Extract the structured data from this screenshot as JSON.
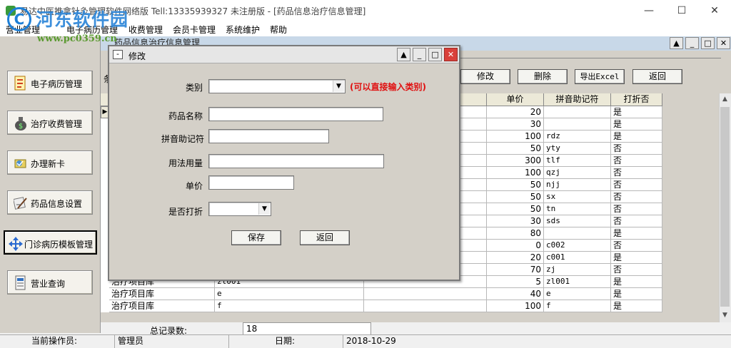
{
  "window": {
    "title": "易达中医推拿针灸管理软件网络版 Tell:13335939327 未注册版 - [药品信息治疗信息管理]",
    "minimize_glyph": "—",
    "maximize_glyph": "☐",
    "close_glyph": "✕"
  },
  "watermark": {
    "text": "河东软件园",
    "url": "www.pc0359.cn",
    "logo_letter": "C"
  },
  "menu": [
    "营业管理",
    "电子病历管理",
    "收费管理",
    "会员卡管理",
    "系统维护",
    "帮助"
  ],
  "sidebar": {
    "items": [
      {
        "label": "电子病历管理",
        "icon": "medical-record-icon"
      },
      {
        "label": "治疗收费管理",
        "icon": "money-bag-icon"
      },
      {
        "label": "办理新卡",
        "icon": "new-card-icon"
      },
      {
        "label": "药品信息设置",
        "icon": "medicine-settings-icon"
      },
      {
        "label": "门诊病历模板管理",
        "icon": "template-arrows-icon"
      },
      {
        "label": "营业查询",
        "icon": "query-icon"
      }
    ]
  },
  "child": {
    "title": "药品信息治疗信息管理",
    "prefix_char": "条",
    "buttons": {
      "edit": "修改",
      "delete": "删除",
      "export": "导出Excel",
      "back": "返回"
    }
  },
  "grid": {
    "columns": [
      "单价",
      "拼音助记符",
      "打折否"
    ],
    "rows": [
      {
        "type": "",
        "name": "",
        "price": "20",
        "pinyin": "",
        "discount": "是"
      },
      {
        "type": "",
        "name": "",
        "price": "30",
        "pinyin": "",
        "discount": "是"
      },
      {
        "type": "",
        "name": "",
        "price": "100",
        "pinyin": "rdz",
        "discount": "是"
      },
      {
        "type": "",
        "name": "",
        "price": "50",
        "pinyin": "yty",
        "discount": "否"
      },
      {
        "type": "",
        "name": "",
        "price": "300",
        "pinyin": "tlf",
        "discount": "否"
      },
      {
        "type": "",
        "name": "",
        "price": "100",
        "pinyin": "qzj",
        "discount": "否"
      },
      {
        "type": "",
        "name": "",
        "price": "50",
        "pinyin": "njj",
        "discount": "否"
      },
      {
        "type": "",
        "name": "",
        "price": "50",
        "pinyin": "sx",
        "discount": "否"
      },
      {
        "type": "",
        "name": "",
        "price": "50",
        "pinyin": "tn",
        "discount": "否"
      },
      {
        "type": "",
        "name": "",
        "price": "30",
        "pinyin": "sds",
        "discount": "否"
      },
      {
        "type": "",
        "name": "",
        "price": "80",
        "pinyin": "",
        "discount": "是"
      },
      {
        "type": "",
        "name": "",
        "price": "0",
        "pinyin": "c002",
        "discount": "否"
      },
      {
        "type": "",
        "name": "",
        "price": "20",
        "pinyin": "c001",
        "discount": "是"
      },
      {
        "type": "",
        "name": "",
        "price": "70",
        "pinyin": "zj",
        "discount": "否"
      },
      {
        "type": "治疗项目库",
        "name": "zl001",
        "price": "5",
        "pinyin": "zl001",
        "discount": "是"
      },
      {
        "type": "治疗项目库",
        "name": "e",
        "price": "40",
        "pinyin": "e",
        "discount": "是"
      },
      {
        "type": "治疗项目库",
        "name": "f",
        "price": "100",
        "pinyin": "f",
        "discount": "是"
      }
    ]
  },
  "totals": {
    "label": "总记录数:",
    "value": "18"
  },
  "status": {
    "operator_label": "当前操作员:",
    "operator": "管理员",
    "date_label": "日期:",
    "date": "2018-10-29"
  },
  "dialog": {
    "title": "修改",
    "fields": {
      "category": {
        "label": "类别",
        "value": ""
      },
      "category_hint": "(可以直接输入类别)",
      "name": {
        "label": "药品名称",
        "value": ""
      },
      "pinyin": {
        "label": "拼音助记符",
        "value": ""
      },
      "usage": {
        "label": "用法用量",
        "value": ""
      },
      "price": {
        "label": "单价",
        "value": ""
      },
      "discount": {
        "label": "是否打折",
        "value": ""
      }
    },
    "buttons": {
      "save": "保存",
      "back": "返回"
    }
  }
}
